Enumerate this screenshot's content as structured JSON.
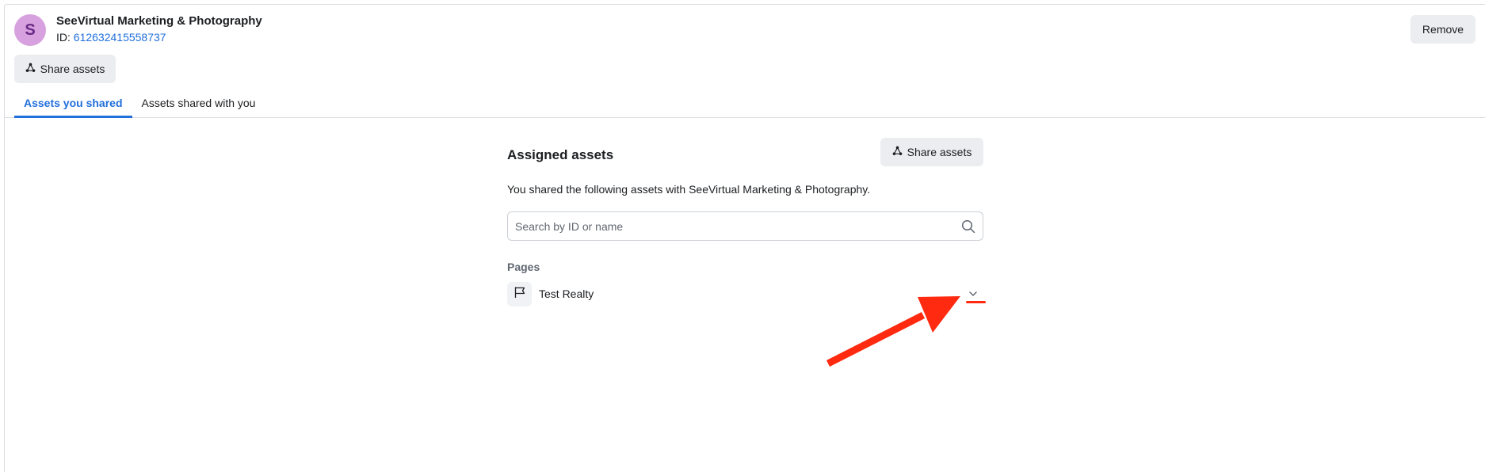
{
  "business": {
    "avatar_letter": "S",
    "name": "SeeVirtual Marketing & Photography",
    "id_label": "ID:",
    "id_value": "612632415558737"
  },
  "header": {
    "remove_label": "Remove",
    "share_label": "Share assets"
  },
  "tabs": [
    {
      "label": "Assets you shared",
      "active": true
    },
    {
      "label": "Assets shared with you",
      "active": false
    }
  ],
  "panel": {
    "title": "Assigned assets",
    "share_label": "Share assets",
    "description": "You shared the following assets with SeeVirtual Marketing & Photography.",
    "search_placeholder": "Search by ID or name",
    "section_label": "Pages",
    "pages": [
      {
        "name": "Test Realty",
        "icon": "flag-icon"
      }
    ]
  },
  "colors": {
    "accent": "#216fdb",
    "annotation": "#ff2a10",
    "avatar_bg": "#d7a0de"
  }
}
